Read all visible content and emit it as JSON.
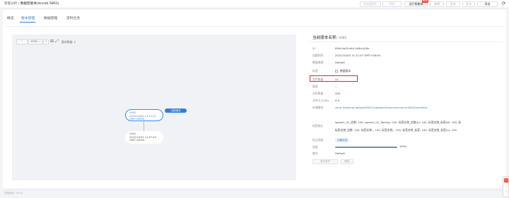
{
  "breadcrumb": {
    "parent": "智能分析 /",
    "current": "数据智能体(dcsstk-5861)"
  },
  "toolbar": {
    "buttons": [
      "开启监控汇",
      "同步",
      "运行智能体",
      "编辑",
      "复制",
      "发布",
      "下载",
      "导出"
    ],
    "new_badge": "NEW",
    "refresh_icon": "refresh-icon"
  },
  "tabs": [
    "概览",
    "版本管理",
    "数据管理",
    "定时任务"
  ],
  "canvas": {
    "zoom_value": "100%",
    "zoom_in": "+",
    "zoom_out": "−",
    "version_count": "版本数量: 2",
    "node_current": {
      "name": "V002",
      "time": "2022/10/20 11:11:47",
      "tz": "GMT+08:00",
      "badge": "当前版本"
    },
    "node_prev": {
      "name": "V001",
      "time": "2022/10/20 11:07:43",
      "tz": "GMT+08:00"
    }
  },
  "detail": {
    "title": "当前版本名称:",
    "version": "V002",
    "rows": [
      {
        "label": "ID",
        "value": "690c0a2f-cfe4-4c8d-b26c"
      },
      {
        "label": "创建时间",
        "value": "2022/10/20 11:11:47 GMT+08:00"
      },
      {
        "label": "数据来源",
        "value": "Default"
      },
      {
        "label": "标签",
        "value": "数据版本"
      },
      {
        "label": "文件数量",
        "value": "21"
      },
      {
        "label": "描述",
        "value": "--"
      },
      {
        "label": "分析数量",
        "value": "200"
      },
      {
        "label": "文件大小(KB)",
        "value": "0.9"
      },
      {
        "label": "存储路径",
        "value": "/smp-test/smp-dataset/5fd-2v/dataset/export/version/V002/manifest"
      }
    ],
    "label_stats_label": "标签统计",
    "label_stats_line1": "speech_01_总数: 100, speech_01_Taming: 100, 标签名称_总数(h): 100, 标签名称_标签(B): 100, 标",
    "label_stats_line2": "标签名称_总数: 100, 标签名称_: 100, 标签名称_: 100, 标签名称_标签: 100, 标签名称_标签(5): 100",
    "status_label": "标注进度",
    "status_button": "创建完成",
    "progress_label": "进度",
    "progress": 1.0,
    "progress_text": "100%",
    "format_label": "格式",
    "format_value": "Default",
    "actions": [
      "发布版本",
      "删除"
    ]
  },
  "footer": {
    "text": "当前版本: V002"
  },
  "side_float": {
    "top": "口",
    "items": [
      "☆",
      "?"
    ]
  }
}
